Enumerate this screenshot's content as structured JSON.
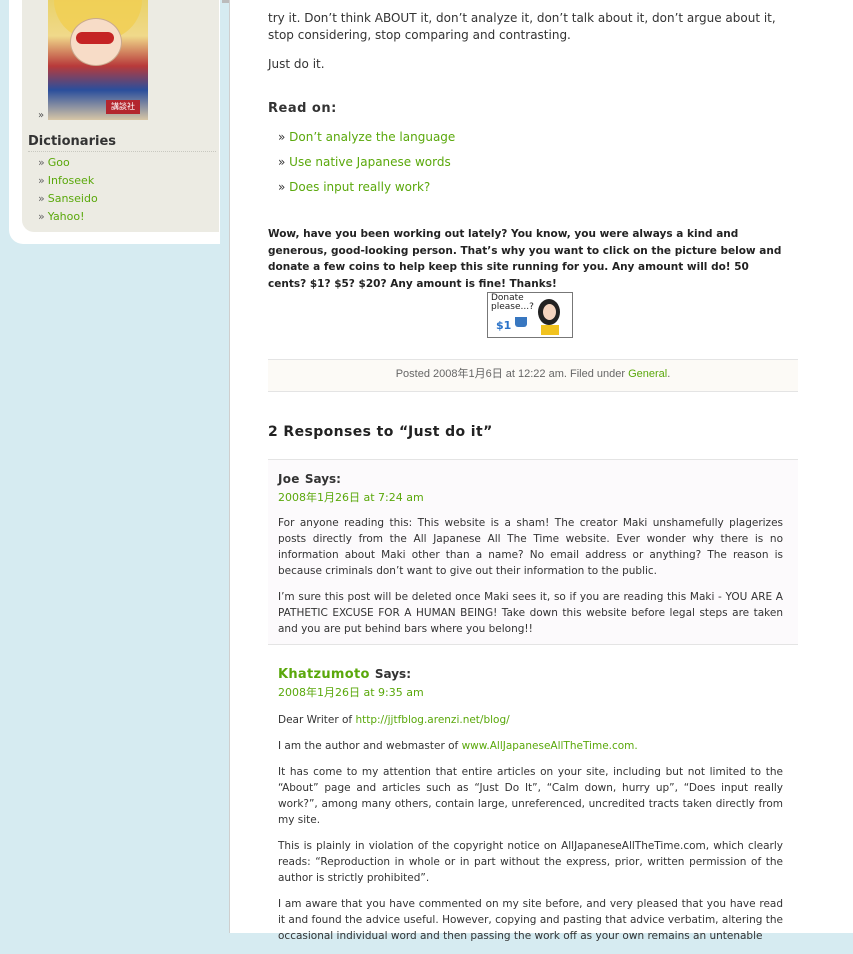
{
  "sidebar": {
    "dictionaries_heading": "Dictionaries",
    "dictionary_links": [
      "Goo",
      "Infoseek",
      "Sanseido",
      "Yahoo!"
    ],
    "bullet": "»",
    "book_stamp": "講談社"
  },
  "article": {
    "intro_text": "try it. Don’t think ABOUT it, don’t analyze it, don’t talk about it, don’t argue about it, stop considering, stop comparing and contrasting.",
    "just_do_it": "Just do it.",
    "read_on_heading": "Read on:",
    "read_on_links": [
      "Don’t analyze the language",
      "Use native Japanese words",
      "Does input really work?"
    ],
    "donate_text": "Wow, have you been working out lately? You know, you were always a kind and generous, good-looking person. That’s why you want to click on the picture below and donate a few coins to help keep this site running for you. Any amount will do! 50 cents? $1? $5? $20? Any amount is fine! Thanks!",
    "donate_button": {
      "line1": "Donate",
      "line2": "please...?",
      "amount": "$1"
    },
    "post_meta": {
      "posted": "Posted 2008年1月6日 at 12:22 am. Filed under ",
      "category": "General",
      "end": "."
    }
  },
  "responses_heading": "2 Responses to “Just do it”",
  "comments": [
    {
      "author": "Joe",
      "says": "Says:",
      "date": "2008年1月26日 at 7:24 am",
      "paragraphs": [
        "For anyone reading this: This website is a sham! The creator Maki unshamefully plagerizes posts directly from the All Japanese All The Time website. Ever wonder why there is no information about Maki other than a name? No email address or anything? The reason is because criminals don’t want to give out their information to the public.",
        "I’m sure this post will be deleted once Maki sees it, so if you are reading this Maki - YOU ARE A PATHETIC EXCUSE FOR A HUMAN BEING! Take down this website before legal steps are taken and you are put behind bars where you belong!!"
      ]
    },
    {
      "author": "Khatzumoto",
      "says": "Says:",
      "date": "2008年1月26日 at 9:35 am",
      "p1_prefix": "Dear Writer of ",
      "p1_link": "http://jjtfblog.arenzi.net/blog/",
      "p2_prefix": "I am the author and webmaster of ",
      "p2_link": "www.AllJapaneseAllTheTime.com.",
      "p3": "It has come to my attention that entire articles on your site, including but not limited to the “About” page and articles such as “Just Do It”, “Calm down, hurry up”, “Does input really work?”, among many others, contain large, unreferenced, uncredited tracts taken directly from my site.",
      "p4": "This is plainly in violation of the copyright notice on AllJapaneseAllTheTime.com, which clearly reads: “Reproduction in whole or in part without the express, prior, written permission of the author is strictly prohibited”.",
      "p5": "I am aware that you have commented on my site before, and very pleased that you have read it and found the advice useful. However, copying and pasting that advice verbatim, altering the occasional individual word and then passing the work off as your own remains an untenable"
    }
  ]
}
